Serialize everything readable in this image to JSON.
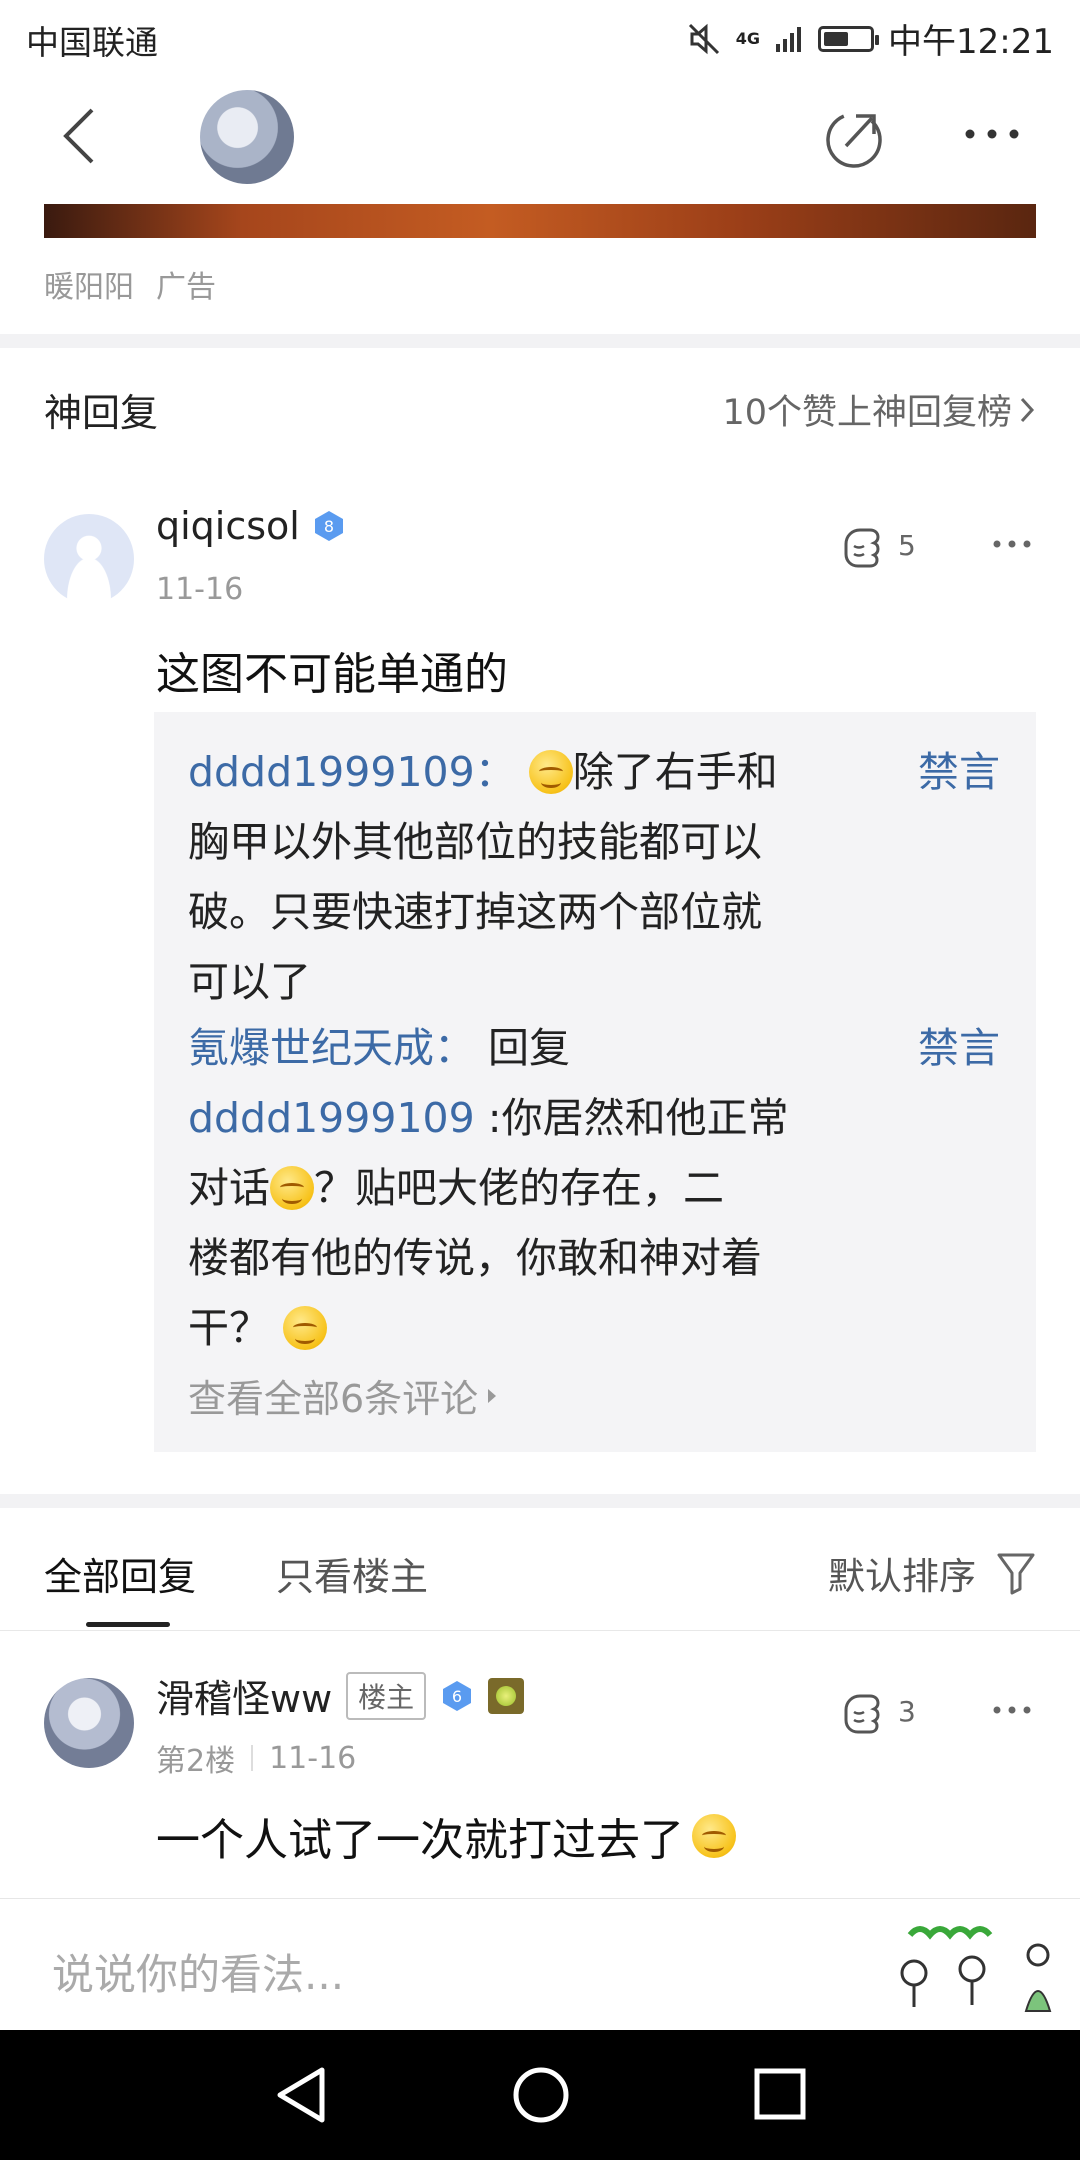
{
  "status_bar": {
    "carrier": "中国联通",
    "time": "中午12:21",
    "network": "4G"
  },
  "ad": {
    "source": "暖阳阳",
    "tag": "广告"
  },
  "god_reply": {
    "section_title": "神回复",
    "rank_link": "10个赞上神回复榜",
    "post": {
      "username": "qiqicsol",
      "level": "8",
      "date": "11-16",
      "likes": "5",
      "text": "这图不可能单通的",
      "replies": [
        {
          "user": "dddd1999109",
          "sep": "：",
          "lines": [
            "除了右手和",
            "胸甲以外其他部位的技能都可以",
            "破。只要快速打掉这两个部位就",
            "可以了"
          ]
        },
        {
          "user": "氪爆世纪天成",
          "sep": "：",
          "lines": [
            "回复",
            "dddd1999109",
            ":你居然和他正常",
            "对话",
            "？贴吧大佬的存在，二",
            "楼都有他的传说，你敢和神对着",
            "干？"
          ]
        }
      ],
      "ban_label": "禁言",
      "view_all": "查看全部6条评论"
    }
  },
  "tabs": {
    "all": "全部回复",
    "owner_only": "只看楼主",
    "sort": "默认排序"
  },
  "floor_post": {
    "username": "滑稽怪ww",
    "owner_badge": "楼主",
    "level": "6",
    "floor": "第2楼",
    "date": "11-16",
    "likes": "3",
    "text": "一个人试了一次就打过去了"
  },
  "input": {
    "placeholder": "说说你的看法..."
  }
}
